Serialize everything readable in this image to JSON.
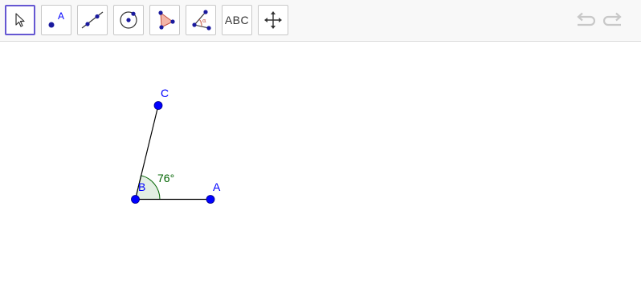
{
  "toolbar": {
    "tools": [
      {
        "name": "move-tool",
        "icon": "cursor-arrow-icon",
        "selected": true
      },
      {
        "name": "point-tool",
        "icon": "point-icon",
        "label": "A"
      },
      {
        "name": "line-tool",
        "icon": "line-through-points-icon"
      },
      {
        "name": "circle-tool",
        "icon": "circle-with-center-icon"
      },
      {
        "name": "polygon-tool",
        "icon": "polygon-icon"
      },
      {
        "name": "angle-tool",
        "icon": "angle-icon",
        "label": "α"
      },
      {
        "name": "text-tool",
        "icon": "text-icon",
        "label": "ABC"
      },
      {
        "name": "move-graphics-view-tool",
        "icon": "move-arrows-icon"
      }
    ],
    "undo": {
      "icon": "undo-icon",
      "enabled": false
    },
    "redo": {
      "icon": "redo-icon",
      "enabled": false
    }
  },
  "construction": {
    "points": [
      {
        "id": "A",
        "label": "A"
      },
      {
        "id": "B",
        "label": "B"
      },
      {
        "id": "C",
        "label": "C"
      }
    ],
    "segments": [
      {
        "from": "B",
        "to": "A"
      },
      {
        "from": "B",
        "to": "C"
      }
    ],
    "angle": {
      "vertex": "B",
      "arms": [
        "A",
        "C"
      ],
      "value_label": "76°"
    }
  },
  "colors": {
    "selected_border": "#6557d2",
    "point_fill": "#0000ff",
    "point_label": "#0000ff",
    "angle_label": "#006400",
    "angle_fill": "#e3efe3",
    "polygon_fill": "#f4b6a8",
    "segment": "#000000",
    "toolbar_bg": "#f8f8f8",
    "history_disabled": "#c8c8c8"
  }
}
